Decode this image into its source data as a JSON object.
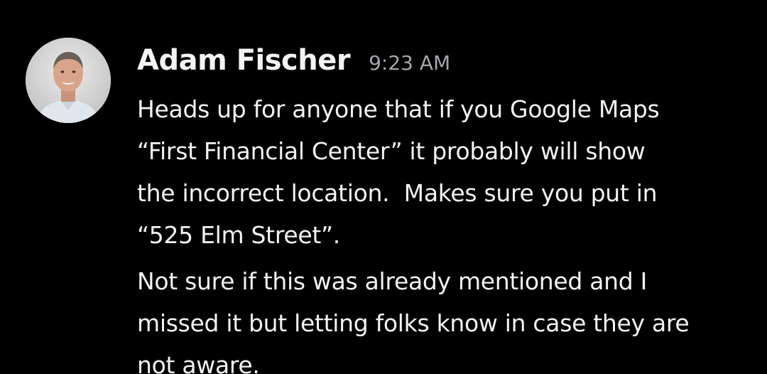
{
  "message": {
    "author": "Adam Fischer",
    "timestamp": "9:23 AM",
    "paragraphs": [
      "Heads up for anyone that if you Google Maps\n“First Financial Center” it probably will show\nthe incorrect location.  Makes sure you put in\n“525 Elm Street”.",
      "Not sure if this was already mentioned and I\nmissed it but letting folks know in case they are\nnot aware."
    ]
  },
  "colors": {
    "background": "#000000",
    "author_text": "#f2f3f5",
    "timestamp_text": "#a3a6aa",
    "body_text": "#f2f3f5"
  }
}
